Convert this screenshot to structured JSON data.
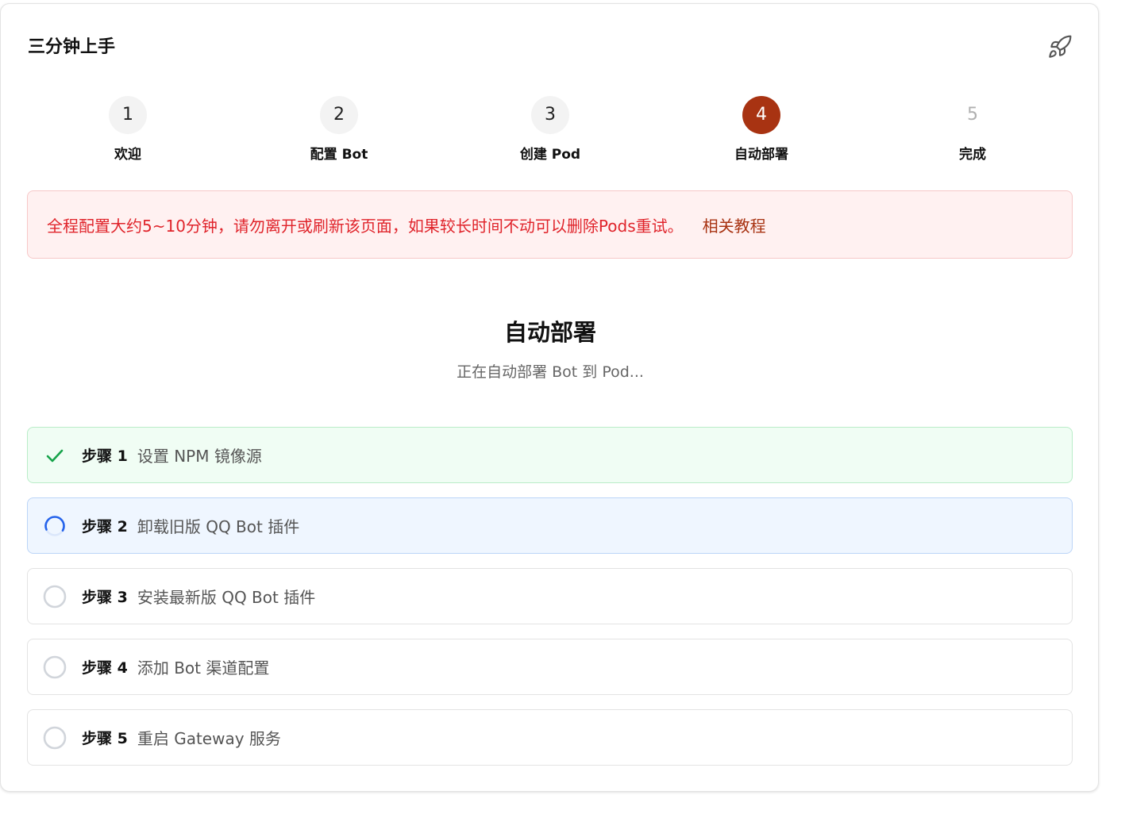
{
  "card": {
    "title": "三分钟上手",
    "header_icon": "rocket-icon"
  },
  "stepper": [
    {
      "number": "1",
      "label": "欢迎",
      "state": "done"
    },
    {
      "number": "2",
      "label": "配置 Bot",
      "state": "done"
    },
    {
      "number": "3",
      "label": "创建 Pod",
      "state": "done"
    },
    {
      "number": "4",
      "label": "自动部署",
      "state": "active"
    },
    {
      "number": "5",
      "label": "完成",
      "state": "pending"
    }
  ],
  "notice": {
    "text": "全程配置大约5~10分钟，请勿离开或刷新该页面，如果较长时间不动可以删除Pods重试。",
    "link": "相关教程"
  },
  "section": {
    "title": "自动部署",
    "subtitle": "正在自动部署 Bot 到 Pod..."
  },
  "tasks": [
    {
      "num": "步骤 1",
      "desc": "设置 NPM 镜像源",
      "status": "done",
      "icon": "check-icon"
    },
    {
      "num": "步骤 2",
      "desc": "卸载旧版 QQ Bot 插件",
      "status": "running",
      "icon": "spinner-icon"
    },
    {
      "num": "步骤 3",
      "desc": "安装最新版 QQ Bot 插件",
      "status": "pending",
      "icon": "circle-icon"
    },
    {
      "num": "步骤 4",
      "desc": "添加 Bot 渠道配置",
      "status": "pending",
      "icon": "circle-icon"
    },
    {
      "num": "步骤 5",
      "desc": "重启 Gateway 服务",
      "status": "pending",
      "icon": "circle-icon"
    }
  ],
  "colors": {
    "accent": "#a83312",
    "danger": "#e0242b",
    "success": "#16a34a",
    "running": "#2563eb",
    "pending": "#d1d5db"
  }
}
